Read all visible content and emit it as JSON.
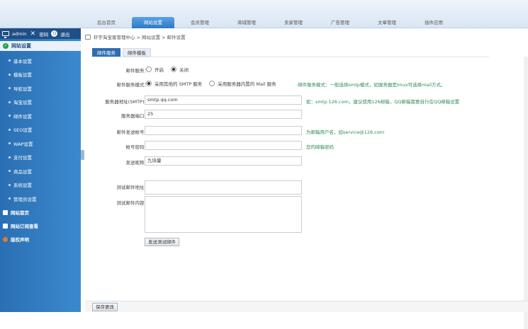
{
  "top_tabs": [
    "后台首页",
    "网站设置",
    "会员管理",
    "商城管理",
    "卖家管理",
    "广告管理",
    "文章管理",
    "插件应用"
  ],
  "sidebar": {
    "user": "admin",
    "password_label": "密码",
    "logout_label": "退出",
    "header": "网站设置",
    "items": [
      "基本设置",
      "模板设置",
      "导航设置",
      "淘宝设置",
      "邮件设置",
      "SEO设置",
      "WAP设置",
      "支付设置",
      "商品设置",
      "系统设置",
      "管理员设置"
    ],
    "sections": [
      "网站首页",
      "网站订阅查看",
      "版权声明"
    ]
  },
  "breadcrumb": "轩宇淘宝客管理中心 > 网站设置 > 邮件设置",
  "subtabs": [
    "邮件服务",
    "邮件模板"
  ],
  "form": {
    "mail_service_label": "邮件服务：",
    "opt_on": "开启",
    "opt_off": "关闭",
    "mail_mode_label": "邮件服务模式：",
    "mode_smtp": "采用其他的 SMTP 服务",
    "mode_builtin": "采用服务器内置的 Mail 服务",
    "mode_hint": "邮件服务模式：一般选择smtp模式，如服务器是linux可选择mail方式。",
    "smtp_label": "服务器地址(SMTP)：",
    "smtp_value": "smtp.qq.com",
    "smtp_hint": "如：smtp.126.com，建议使用126邮箱，QQ邮箱需要自行在QQ邮箱设置",
    "port_label": "服务器端口：",
    "port_value": "25",
    "account_label": "邮件发送帐号：",
    "account_hint": "为邮箱用户名，如service@126.com",
    "password_label": "帐号密码：",
    "password_hint": "您的邮箱密码",
    "sender_label": "发送昵称：",
    "sender_value": "九块量",
    "test_addr_label": "测试邮件地址：",
    "test_body_label": "测试邮件内容：",
    "send_test_button": "发送测试邮件",
    "save_button": "保存更改"
  }
}
